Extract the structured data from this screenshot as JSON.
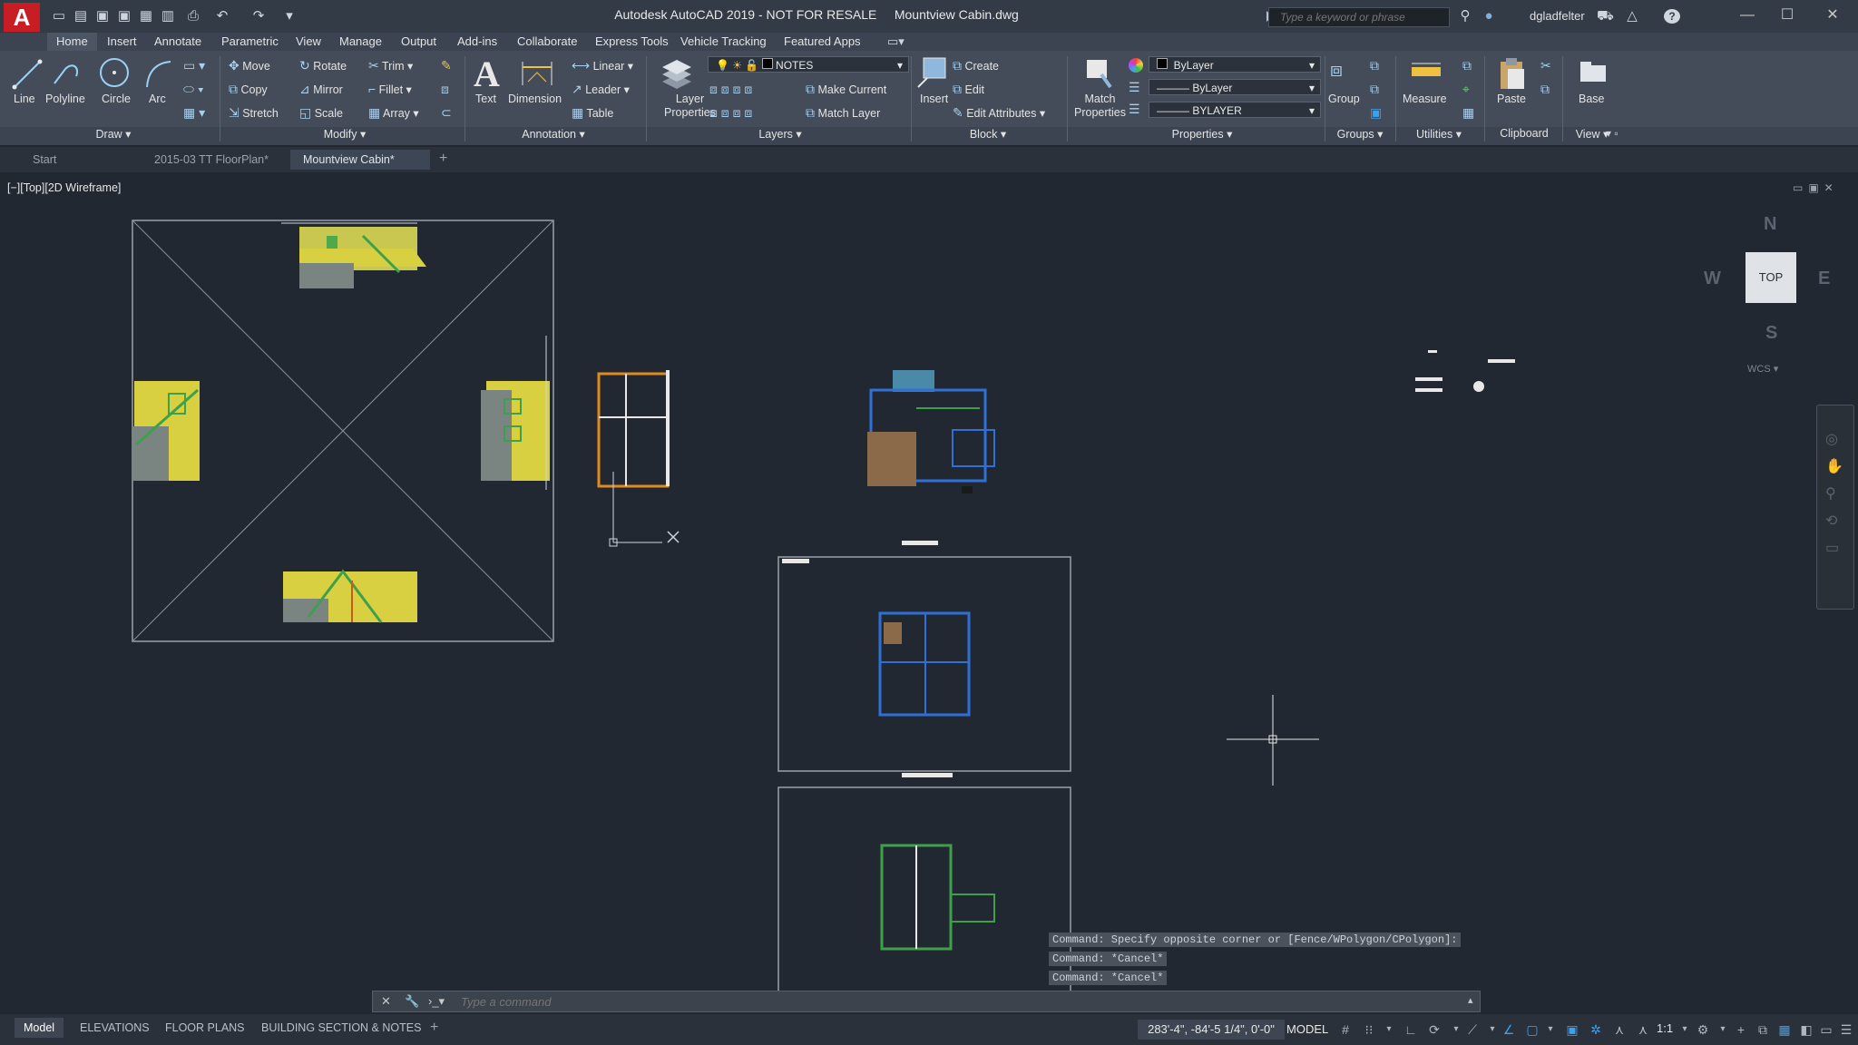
{
  "app": {
    "logo": "A",
    "title": "Autodesk AutoCAD 2019 - NOT FOR RESALE     Mountview Cabin.dwg"
  },
  "search": {
    "placeholder": "Type a keyword or phrase"
  },
  "user": {
    "name": "dgladfelter"
  },
  "ribbon_tabs": [
    "Home",
    "Insert",
    "Annotate",
    "Parametric",
    "View",
    "Manage",
    "Output",
    "Add-ins",
    "Collaborate",
    "Express Tools",
    "Vehicle Tracking",
    "Featured Apps"
  ],
  "draw": {
    "line": "Line",
    "polyline": "Polyline",
    "circle": "Circle",
    "arc": "Arc",
    "label": "Draw"
  },
  "modify": {
    "move": "Move",
    "rotate": "Rotate",
    "trim": "Trim",
    "copy": "Copy",
    "mirror": "Mirror",
    "fillet": "Fillet",
    "stretch": "Stretch",
    "scale": "Scale",
    "array": "Array",
    "label": "Modify"
  },
  "annotation": {
    "text": "Text",
    "dimension": "Dimension",
    "linear": "Linear",
    "leader": "Leader",
    "table": "Table",
    "label": "Annotation"
  },
  "layers": {
    "layer_properties_1": "Layer",
    "layer_properties_2": "Properties",
    "current_layer": "NOTES",
    "make_current": "Make Current",
    "match_layer": "Match Layer",
    "label": "Layers"
  },
  "block": {
    "insert": "Insert",
    "create": "Create",
    "edit": "Edit",
    "edit_attributes": "Edit Attributes",
    "label": "Block"
  },
  "properties": {
    "match_1": "Match",
    "match_2": "Properties",
    "color": "ByLayer",
    "linetype": "ByLayer",
    "lineweight": "BYLAYER",
    "label": "Properties"
  },
  "groups": {
    "group": "Group",
    "label": "Groups"
  },
  "utilities": {
    "measure": "Measure",
    "label": "Utilities"
  },
  "clipboard": {
    "paste": "Paste",
    "label": "Clipboard"
  },
  "view_panel": {
    "base": "Base",
    "label": "View"
  },
  "file_tabs": [
    "Start",
    "2015-03 TT FloorPlan*",
    "Mountview Cabin*"
  ],
  "viewport": {
    "label": "[−][Top][2D Wireframe]"
  },
  "viewcube": {
    "top": "TOP",
    "n": "N",
    "s": "S",
    "e": "E",
    "w": "W",
    "wcs": "WCS"
  },
  "command": {
    "history": [
      "Command: Specify opposite corner or [Fence/WPolygon/CPolygon]:",
      "Command: *Cancel*",
      "Command: *Cancel*"
    ],
    "placeholder": "Type a command"
  },
  "layout_tabs": [
    "Model",
    "ELEVATIONS",
    "FLOOR PLANS",
    "BUILDING SECTION & NOTES"
  ],
  "status": {
    "coords": "283'-4\", -84'-5 1/4\", 0'-0\"",
    "space": "MODEL",
    "scale": "1:1"
  },
  "colors": {
    "accent": "#3ba2f0",
    "logo": "#c81d25",
    "ribbon": "#434c58",
    "canvas": "#222831",
    "elevation_fill": "#d8d040",
    "plan_lines": "#2f6fd6"
  }
}
